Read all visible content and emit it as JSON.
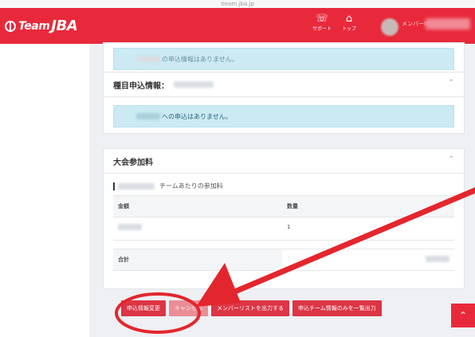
{
  "browser": {
    "title": "tieam.jba.jp"
  },
  "header": {
    "logo_team": "Team",
    "logo_jba": "JBA",
    "support_label": "サポート",
    "top_label": "トップ",
    "member_label": "メンバーID"
  },
  "cards": {
    "prev_info": {
      "text": "の申込情報はありません。"
    },
    "event_app": {
      "title": "種目申込情報：",
      "info": "への申込はありません。"
    },
    "fee": {
      "title": "大会参加料",
      "section_label": "チームあたりの参加料",
      "columns": [
        "金額",
        "数量"
      ],
      "row": {
        "amount": "",
        "qty": "1"
      },
      "total_label": "合計"
    }
  },
  "actions": {
    "edit": "申込情報変更",
    "cancel": "キャンセル",
    "export_members": "メンバーリストを出力する",
    "export_team": "申込チーム情報のみを一覧出力"
  },
  "colors": {
    "brand": "#e8293b",
    "annotation": "#e3262e"
  }
}
